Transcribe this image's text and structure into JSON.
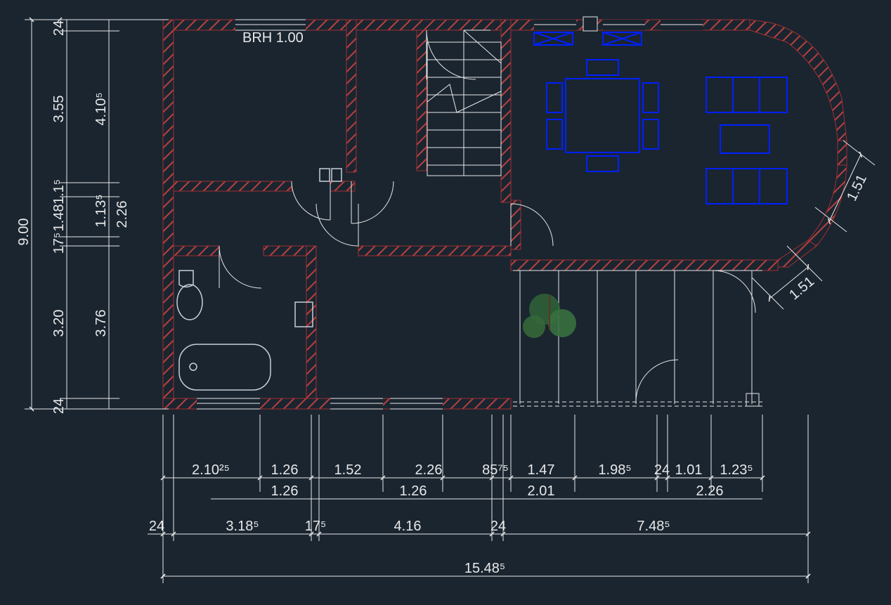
{
  "drawing": {
    "label_brh": "BRH 1.00",
    "dims_vertical_outer": {
      "total": "9.00"
    },
    "dims_vertical_inner1": [
      "24",
      "3.55",
      "1.1⁵",
      "1.48",
      "17⁵",
      "3.20",
      "24"
    ],
    "dims_vertical_inner2": [
      "4.10⁵",
      "1.13⁵",
      "2.26",
      "3.76"
    ],
    "dims_right_angled": [
      "1.51",
      "1.51"
    ],
    "dims_h_row1": [
      "2.10²⁵",
      "1.26",
      "1.52",
      "2.26",
      "85⁷⁵",
      "1.47",
      "1.98⁵",
      "24",
      "1.01",
      "1.23⁵"
    ],
    "dims_h_row2": [
      "1.26",
      "1.26",
      "2.01",
      "2.26"
    ],
    "dims_h_row3": [
      "24",
      "3.18⁵",
      "17⁵",
      "4.16",
      "24",
      "7.48⁵"
    ],
    "dims_h_row4": [
      "15.48⁵"
    ],
    "colors": {
      "bg": "#1a2530",
      "hatch": "#b84040",
      "furniture": "#0020ff",
      "lines": "#e8e8e8",
      "plant": "#3a7040"
    }
  }
}
